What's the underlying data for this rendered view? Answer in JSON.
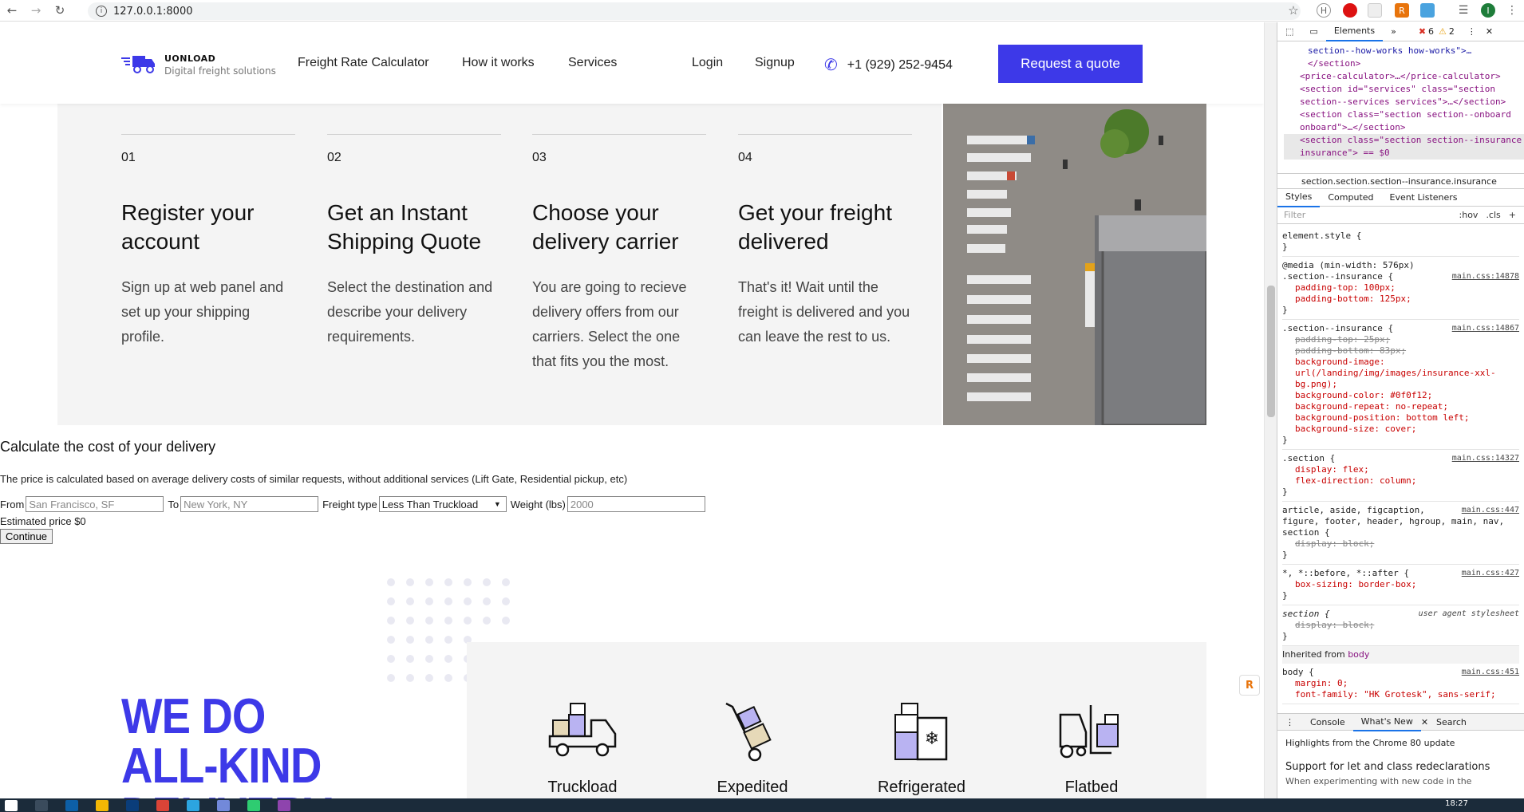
{
  "browser": {
    "url": "127.0.0.1:8000",
    "back_icon": "arrow-left-icon",
    "forward_icon": "arrow-right-icon",
    "reload_icon": "reload-icon",
    "error_count": "6",
    "warning_count": "2"
  },
  "header": {
    "brand": "UONLOAD",
    "tagline": "Digital freight solutions",
    "nav": [
      "Freight Rate Calculator",
      "How it works",
      "Services"
    ],
    "login": "Login",
    "signup": "Signup",
    "phone": "+1 (929) 252-9454",
    "cta": "Request a quote"
  },
  "steps": [
    {
      "num": "01",
      "title": "Register your account",
      "desc": "Sign up at web panel and set up your shipping profile."
    },
    {
      "num": "02",
      "title": "Get an Instant Shipping Quote",
      "desc": "Select the destination and describe your delivery requirements."
    },
    {
      "num": "03",
      "title": "Choose your delivery carrier",
      "desc": "You are going to recieve delivery offers from our carriers. Select the one that fits you the most."
    },
    {
      "num": "04",
      "title": "Get your freight delivered",
      "desc": "That's it! Wait until the freight is delivered and you can leave the rest to us."
    }
  ],
  "calculator": {
    "title": "Calculate the cost of your delivery",
    "description": "The price is calculated based on average delivery costs of similar requests, without additional services (Lift Gate, Residential pickup, etc)",
    "from_label": "From",
    "from_placeholder": "San Francisco, SF",
    "to_label": "To",
    "to_placeholder": "New York, NY",
    "freight_label": "Freight type",
    "freight_value": "Less Than Truckload",
    "weight_label": "Weight (lbs)",
    "weight_placeholder": "2000",
    "estimate": "Estimated price $0",
    "continue": "Continue"
  },
  "services": {
    "headline_1": "WE DO",
    "headline_2": "ALL-KIND",
    "headline_3": "DELIVERY",
    "items": [
      "Truckload",
      "Expedited",
      "Refrigerated",
      "Flatbed"
    ]
  },
  "devtools": {
    "tabs": [
      "Elements"
    ],
    "breadcrumb": "section.section.section--insurance.insurance",
    "subtabs": [
      "Styles",
      "Computed",
      "Event Listeners"
    ],
    "filter_placeholder": "Filter",
    "hov": ":hov",
    "cls": ".cls",
    "tree": [
      "section--how-works how-works\">…",
      "</section>",
      "<price-calculator>…</price-calculator>",
      "<section id=\"services\" class=\"section section--services services\">…</section>",
      "<section class=\"section section--onboard onboard\">…</section>",
      "<section class=\"section section--insurance insurance\"> == $0"
    ],
    "element_style": "element.style {",
    "media": "@media (min-width: 576px)",
    "rule1_sel": ".section--insurance {",
    "rule1_src": "main.css:14878",
    "rule1_props": [
      "padding-top: 100px;",
      "padding-bottom: 125px;"
    ],
    "rule2_sel": ".section--insurance {",
    "rule2_src": "main.css:14867",
    "rule2_struck": [
      "padding-top: 25px;",
      "padding-bottom: 83px;"
    ],
    "rule2_props": [
      "background-image: url(/landing/img/images/insurance-xxl-bg.png);",
      "background-color: #0f0f12;",
      "background-repeat: no-repeat;",
      "background-position: bottom left;",
      "background-size: cover;"
    ],
    "rule3_sel": ".section {",
    "rule3_src": "main.css:14327",
    "rule3_props": [
      "display: flex;",
      "flex-direction: column;"
    ],
    "rule4_sel": "article, aside, figcaption, figure, footer, header, hgroup, main, nav, section {",
    "rule4_src": "main.css:447",
    "rule4_struck": [
      "display: block;"
    ],
    "rule5_sel": "*, *::before, *::after {",
    "rule5_src": "main.css:427",
    "rule5_props": [
      "box-sizing: border-box;"
    ],
    "rule6_sel": "section {",
    "rule6_src": "user agent stylesheet",
    "rule6_struck": [
      "display: block;"
    ],
    "inherited": "Inherited from",
    "inherited_el": "body",
    "body_sel": "body {",
    "body_src": "main.css:451",
    "body_props": [
      "margin: 0;",
      "font-family: \"HK Grotesk\", sans-serif;"
    ],
    "console_tabs": [
      "Console",
      "What's New",
      "Search"
    ],
    "whatsnew_title": "Highlights from the Chrome 80 update",
    "whatsnew_item": "Support for let and class redeclarations",
    "whatsnew_text": "When experimenting with new code in the"
  },
  "taskbar": {
    "time": "18:27"
  },
  "colors": {
    "accent": "#3d39e8",
    "section_bg": "#f4f4f4",
    "taskbar": "#1b2b3a"
  }
}
